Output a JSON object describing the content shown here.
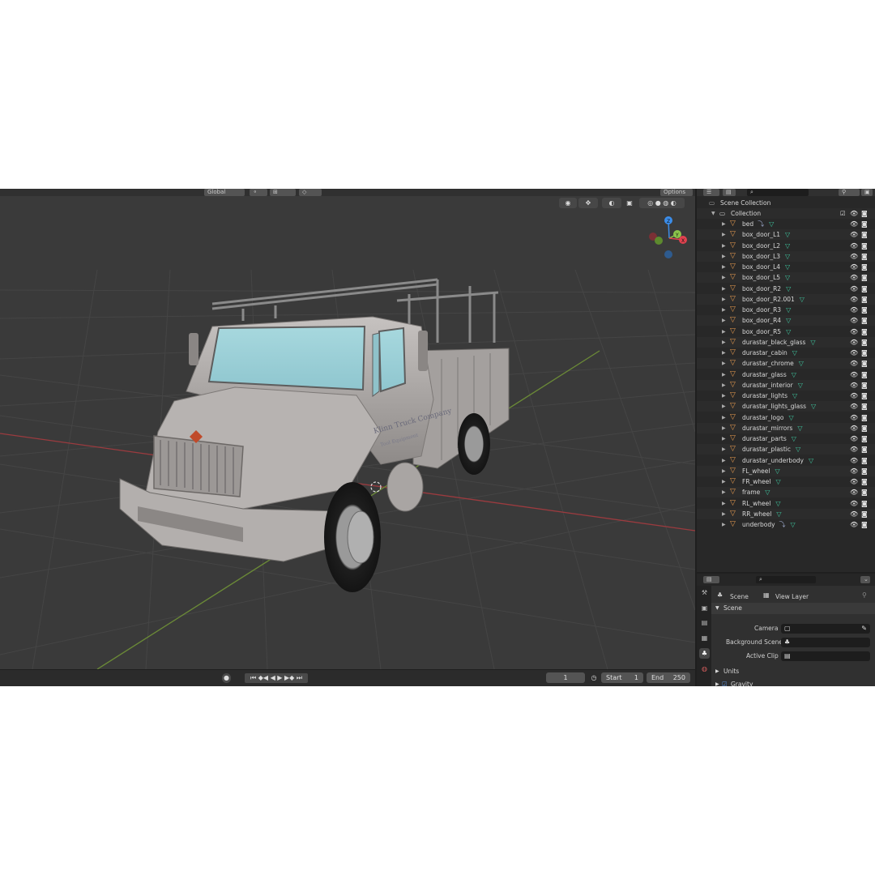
{
  "viewport": {
    "header": {
      "orientation": "Global",
      "options": "Options"
    },
    "gizmo": {
      "z": "Z",
      "y": "Y",
      "x": "X"
    },
    "decal_text": [
      "Klinn Truck Company",
      "Tool Equipment"
    ]
  },
  "timeline": {
    "current_frame": "1",
    "start_label": "Start",
    "start_value": "1",
    "end_label": "End",
    "end_value": "250"
  },
  "outliner": {
    "scene_collection": "Scene Collection",
    "collection": "Collection",
    "objects": [
      {
        "name": "bed",
        "modifier": true
      },
      {
        "name": "box_door_L1",
        "modifier": false
      },
      {
        "name": "box_door_L2",
        "modifier": false
      },
      {
        "name": "box_door_L3",
        "modifier": false
      },
      {
        "name": "box_door_L4",
        "modifier": false
      },
      {
        "name": "box_door_L5",
        "modifier": false
      },
      {
        "name": "box_door_R2",
        "modifier": false
      },
      {
        "name": "box_door_R2.001",
        "modifier": false
      },
      {
        "name": "box_door_R3",
        "modifier": false
      },
      {
        "name": "box_door_R4",
        "modifier": false
      },
      {
        "name": "box_door_R5",
        "modifier": false
      },
      {
        "name": "durastar_black_glass",
        "modifier": false
      },
      {
        "name": "durastar_cabin",
        "modifier": false
      },
      {
        "name": "durastar_chrome",
        "modifier": false
      },
      {
        "name": "durastar_glass",
        "modifier": false
      },
      {
        "name": "durastar_interior",
        "modifier": false
      },
      {
        "name": "durastar_lights",
        "modifier": false
      },
      {
        "name": "durastar_lights_glass",
        "modifier": false
      },
      {
        "name": "durastar_logo",
        "modifier": false
      },
      {
        "name": "durastar_mirrors",
        "modifier": false
      },
      {
        "name": "durastar_parts",
        "modifier": false
      },
      {
        "name": "durastar_plastic",
        "modifier": false
      },
      {
        "name": "durastar_underbody",
        "modifier": false
      },
      {
        "name": "FL_wheel",
        "modifier": false
      },
      {
        "name": "FR_wheel",
        "modifier": false
      },
      {
        "name": "frame",
        "modifier": false
      },
      {
        "name": "RL_wheel",
        "modifier": false
      },
      {
        "name": "RR_wheel",
        "modifier": false
      },
      {
        "name": "underbody",
        "modifier": true
      }
    ]
  },
  "properties": {
    "breadcrumb_scene": "Scene",
    "breadcrumb_view_layer": "View Layer",
    "panel_scene": "Scene",
    "camera_label": "Camera",
    "background_scene_label": "Background Scene",
    "active_clip_label": "Active Clip",
    "panel_units": "Units",
    "panel_gravity": "Gravity"
  },
  "colors": {
    "axis_x": "#e0424f",
    "axis_y": "#8bc34a",
    "axis_z": "#3b8dea",
    "object_icon": "#e69a4f",
    "mesh_icon": "#3fc7a0"
  }
}
